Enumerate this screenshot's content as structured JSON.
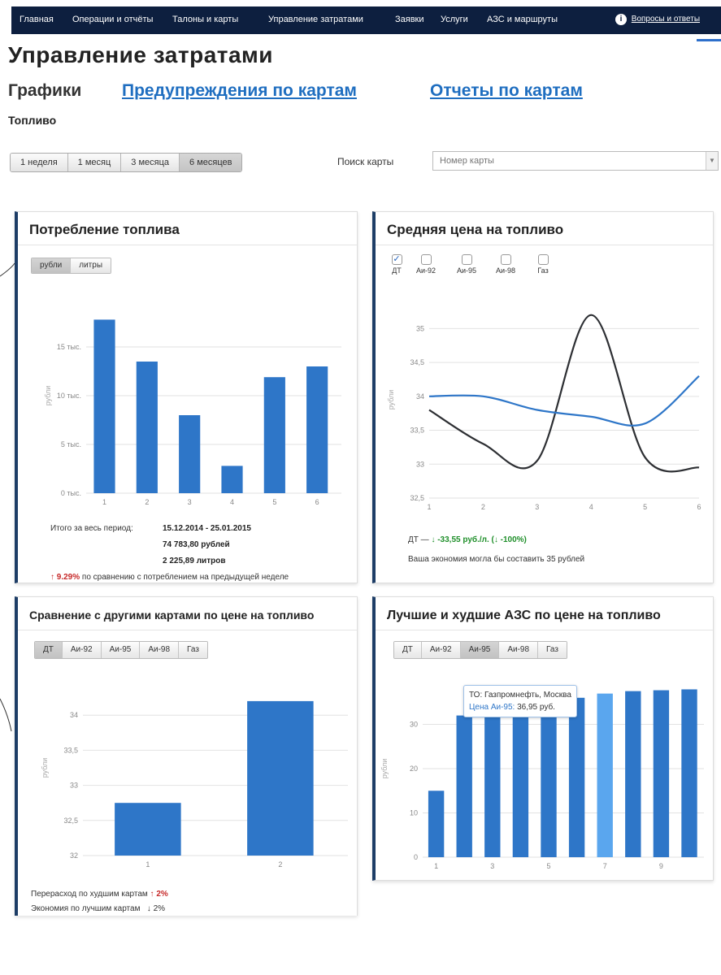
{
  "nav": {
    "items": [
      "Главная",
      "Операции и отчёты",
      "Талоны и карты",
      "Управление затратами",
      "Заявки",
      "Услуги",
      "АЗС и маршруты"
    ],
    "help": "Вопросы и ответы"
  },
  "page": {
    "title": "Управление затратами",
    "tabs": {
      "current": "Графики",
      "warnings": "Предупреждения по картам",
      "reports": "Отчеты по картам"
    },
    "section": "Топливо"
  },
  "periods": [
    "1 неделя",
    "1 месяц",
    "3 месяца",
    "6 месяцев"
  ],
  "search": {
    "label": "Поиск карты",
    "placeholder": "Номер карты"
  },
  "colors": {
    "nav_bg": "#0d1f3f",
    "accent_blue": "#2e76c8",
    "highlight_blue": "#5aa6ee",
    "dark_line": "#2d2f33",
    "red": "#c62828",
    "green": "#1f8f2a"
  },
  "panels": {
    "consumption": {
      "title": "Потребление топлива",
      "toggle": [
        "рубли",
        "литры"
      ],
      "period_label": "Итого за весь период:",
      "period_value": "15.12.2014 - 25.01.2015",
      "rubles": "74 783,80 рублей",
      "liters": "2 225,89 литров",
      "change_pct": "↑ 9.29%",
      "change_text": "по сравнению с потреблением на предыдущей неделе"
    },
    "avgprice": {
      "title": "Средняя цена на топливо",
      "fuels": [
        "ДТ",
        "Аи-92",
        "Аи-95",
        "Аи-98",
        "Газ"
      ],
      "checked_fuel": "ДТ",
      "result_prefix": "ДТ —",
      "result_value": "↓ -33,55 руб./л. (↓ -100%)",
      "savings_text": "Ваша экономия могла бы составить 35 рублей"
    },
    "compare": {
      "title": "Сравнение с другими картами по цене на топливо",
      "fuels": [
        "ДТ",
        "Аи-92",
        "Аи-95",
        "Аи-98",
        "Газ"
      ],
      "active_fuel": "ДТ",
      "overspend_label": "Перерасход по худшим картам",
      "overspend_value": "↑ 2%",
      "savings_label": "Экономия по лучшим картам",
      "savings_value": "↓ 2%"
    },
    "stations": {
      "title": "Лучшие и худшие АЗС по цене на топливо",
      "fuels": [
        "ДТ",
        "Аи-92",
        "Аи-95",
        "Аи-98",
        "Газ"
      ],
      "active_fuel": "Аи-95",
      "tooltip_line1": "ТО: Газпромнефть, Москва",
      "tooltip_label": "Цена Аи-95:",
      "tooltip_value": "36,95 руб."
    }
  },
  "chart_data": [
    {
      "id": "consumption",
      "type": "bar",
      "categories": [
        "1",
        "2",
        "3",
        "4",
        "5",
        "6"
      ],
      "values": [
        17800,
        13500,
        8000,
        2800,
        11900,
        13000
      ],
      "ylabel": "рубли",
      "yticks": [
        "0 тыс.",
        "5 тыс.",
        "10 тыс.",
        "15 тыс."
      ],
      "ylim": [
        0,
        20000
      ],
      "grid": true
    },
    {
      "id": "avgprice",
      "type": "line",
      "x": [
        1,
        2,
        3,
        4,
        5,
        6
      ],
      "series": [
        {
          "values": [
            33.8,
            33.3,
            33.05,
            35.2,
            33.1,
            32.95
          ]
        },
        {
          "values": [
            34.0,
            34.0,
            33.8,
            33.7,
            33.6,
            34.3
          ]
        }
      ],
      "ylabel": "рубли",
      "yticks": [
        "32,5",
        "33",
        "33,5",
        "34",
        "34,5",
        "35"
      ],
      "ylim": [
        32.5,
        35.4
      ],
      "grid": true
    },
    {
      "id": "compare",
      "type": "bar",
      "categories": [
        "1",
        "2"
      ],
      "values": [
        32.75,
        34.2
      ],
      "ylabel": "рубли",
      "yticks": [
        "32",
        "32,5",
        "33",
        "33,5",
        "34"
      ],
      "ylim": [
        32,
        34.5
      ],
      "grid": true
    },
    {
      "id": "stations",
      "type": "bar",
      "categories": [
        "1",
        "2",
        "3",
        "4",
        "5",
        "6",
        "7",
        "8",
        "9",
        "10"
      ],
      "xticks": [
        "1",
        "3",
        "5",
        "7",
        "9"
      ],
      "values": [
        15,
        32,
        33,
        34,
        35,
        36,
        36.95,
        37.5,
        37.7,
        37.9
      ],
      "highlight_index": 6,
      "ylabel": "рубли",
      "yticks": [
        "0",
        "10",
        "20",
        "30"
      ],
      "ylim": [
        0,
        40
      ],
      "grid": true
    }
  ]
}
